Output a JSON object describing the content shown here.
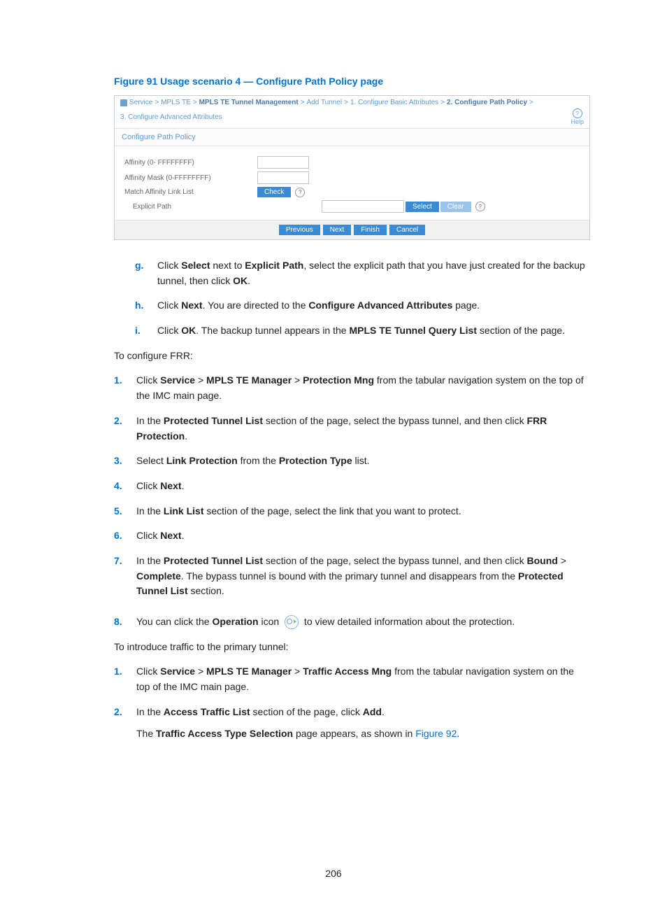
{
  "figure_title": "Figure 91 Usage scenario 4 — Configure Path Policy page",
  "shot": {
    "crumbs": [
      "Service",
      "MPLS TE",
      "MPLS TE Tunnel Management",
      "Add Tunnel",
      "1. Configure Basic Attributes",
      "2. Configure Path Policy",
      "3. Configure Advanced Attributes"
    ],
    "crumbs_strong_index": [
      2,
      5
    ],
    "help_label": "Help",
    "subhead": "Configure Path Policy",
    "labels": {
      "affinity": "Affinity (0- FFFFFFFF)",
      "mask": "Affinity Mask (0-FFFFFFFF)",
      "match": "Match Affinity Link List",
      "explicit": "Explicit Path"
    },
    "buttons": {
      "check": "Check",
      "select": "Select",
      "clear": "Clear",
      "previous": "Previous",
      "next": "Next",
      "finish": "Finish",
      "cancel": "Cancel"
    }
  },
  "steps_lower": {
    "g": {
      "marker": "g.",
      "pre": "Click ",
      "b1": "Select",
      "mid": " next to ",
      "b2": "Explicit Path",
      "post": ", select the explicit path that you have just created for the backup tunnel, then click ",
      "b3": "OK",
      "end": "."
    },
    "h": {
      "marker": "h.",
      "pre": "Click ",
      "b1": "Next",
      "mid": ". You are directed to the ",
      "b2": "Configure Advanced Attributes",
      "post": " page."
    },
    "i": {
      "marker": "i.",
      "pre": "Click ",
      "b1": "OK",
      "mid": ". The backup tunnel appears in the ",
      "b2": "MPLS TE Tunnel Query List",
      "post": " section of the page."
    }
  },
  "lead1": "To configure FRR:",
  "frr": {
    "1": {
      "mk": "1.",
      "pre": "Click ",
      "b1": "Service",
      "sep1": " > ",
      "b2": "MPLS TE Manager",
      "sep2": " > ",
      "b3": "Protection Mng",
      "post": " from the tabular navigation system on the top of the IMC main page."
    },
    "2": {
      "mk": "2.",
      "pre": "In the ",
      "b1": "Protected Tunnel List",
      "mid": " section of the page, select the bypass tunnel, and then click ",
      "b2": "FRR Protection",
      "end": "."
    },
    "3": {
      "mk": "3.",
      "pre": "Select ",
      "b1": "Link Protection",
      "mid": " from the ",
      "b2": "Protection Type",
      "post": " list."
    },
    "4": {
      "mk": "4.",
      "pre": "Click ",
      "b1": "Next",
      "end": "."
    },
    "5": {
      "mk": "5.",
      "pre": "In the ",
      "b1": "Link List",
      "post": " section of the page, select the link that you want to protect."
    },
    "6": {
      "mk": "6.",
      "pre": "Click ",
      "b1": "Next",
      "end": "."
    },
    "7": {
      "mk": "7.",
      "pre": "In the ",
      "b1": "Protected Tunnel List",
      "mid": " section of the page, select the bypass tunnel, and then click ",
      "b2": "Bound",
      "sep": " > ",
      "b3": "Complete",
      "post": ". The bypass tunnel is bound with the primary tunnel and disappears from the ",
      "b4": "Protected Tunnel List",
      "end": " section."
    },
    "8": {
      "mk": "8.",
      "pre": "You can click the ",
      "b1": "Operation",
      "mid": " icon ",
      "post": " to view detailed information about the protection."
    }
  },
  "lead2": "To introduce traffic to the primary tunnel:",
  "tr": {
    "1": {
      "mk": "1.",
      "pre": "Click ",
      "b1": "Service",
      "sep1": " > ",
      "b2": "MPLS TE Manager",
      "sep2": " > ",
      "b3": "Traffic Access Mng",
      "post": " from the tabular navigation system on the top of the IMC main page."
    },
    "2": {
      "mk": "2.",
      "pre": "In the ",
      "b1": "Access Traffic List",
      "mid": " section of the page, click ",
      "b2": "Add",
      "end": ".",
      "sub_pre": "The ",
      "sub_b": "Traffic Access Type Selection",
      "sub_mid": " page appears, as shown in ",
      "sub_link": "Figure 92",
      "sub_end": "."
    }
  },
  "pagenum": "206"
}
